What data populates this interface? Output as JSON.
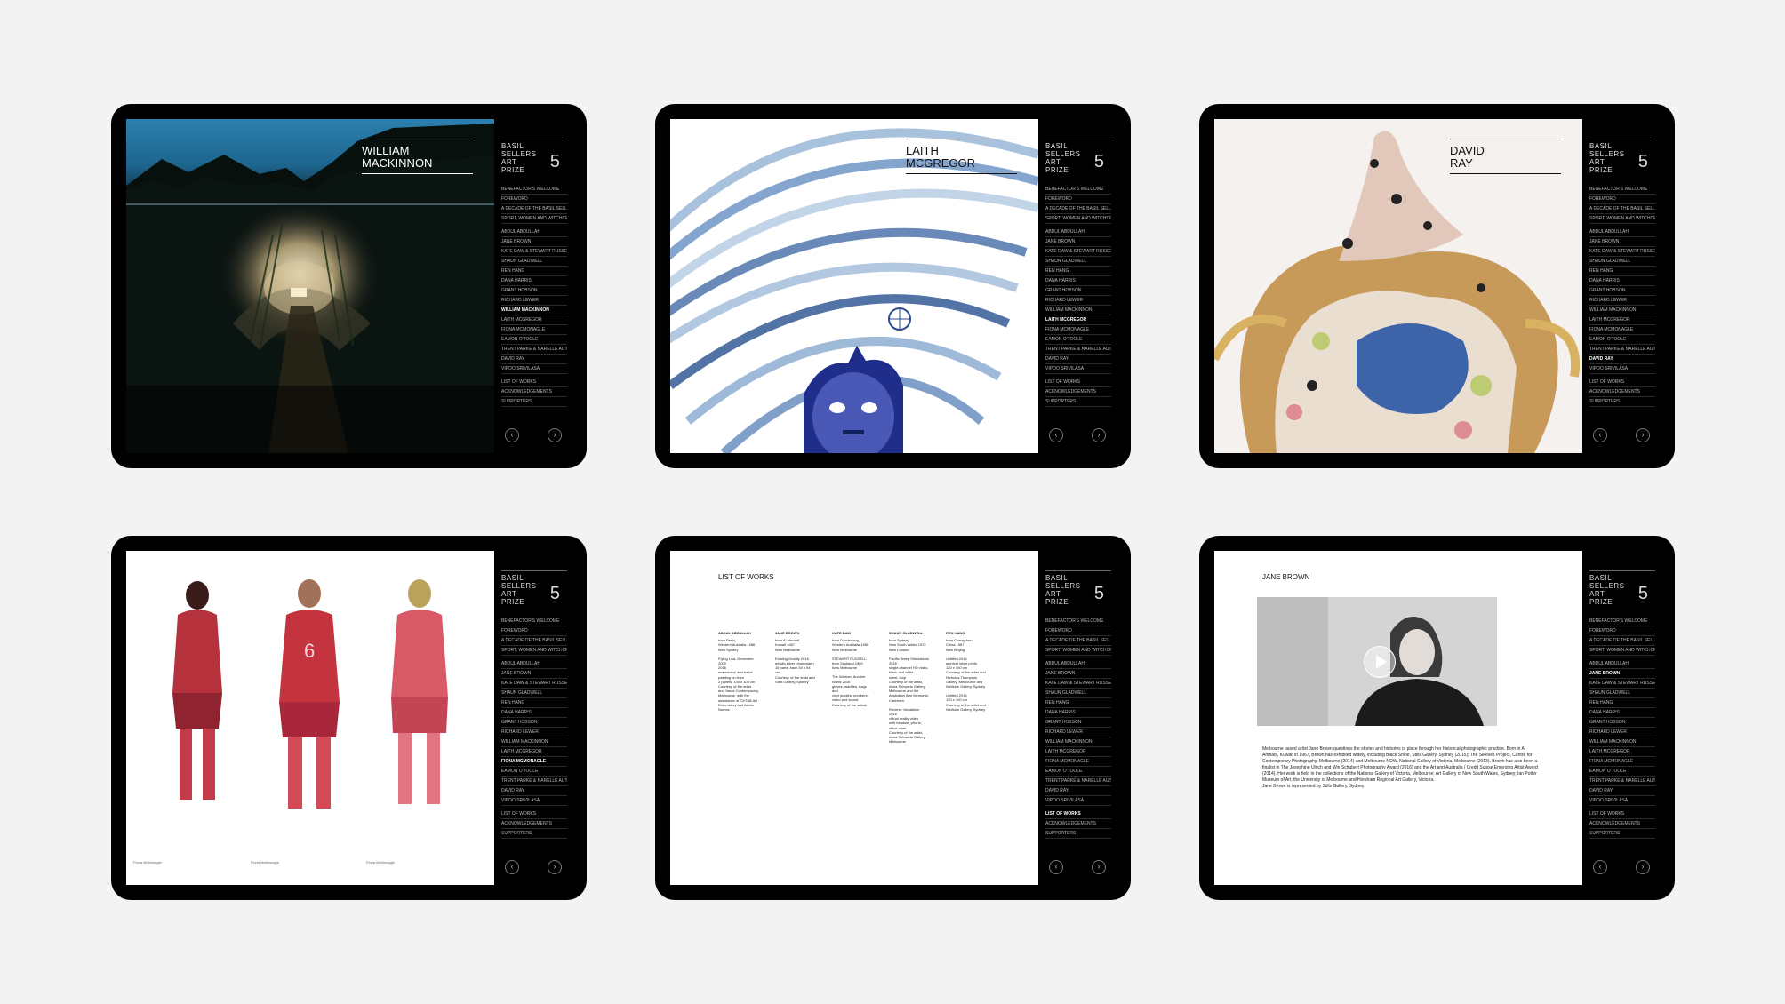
{
  "sidebar": {
    "logo": [
      "BASIL",
      "SELLERS",
      "ART",
      "PRIZE"
    ],
    "logo_number": "5",
    "nav_top": [
      "BENEFACTOR'S WELCOME",
      "FOREWORD",
      "A DECADE OF THE BASIL SELLERS ART PRIZE",
      "SPORT, WOMEN AND WITCHCRAFT"
    ],
    "nav_artists": [
      "ABDUL ABDULLAH",
      "JANE BROWN",
      "KATE DAW & STEWART RUSSELL",
      "SHAUN GLADWELL",
      "REN HANG",
      "DANA HARRIS",
      "GRANT HOBSON",
      "RICHARD LEWER",
      "WILLIAM MACKINNON",
      "LAITH McGREGOR",
      "FIONA McMONAGLE",
      "EAMON O'TOOLE",
      "TRENT PARKE & NARELLE AUTIO",
      "DAVID RAY",
      "VIPOO SRIVILASA"
    ],
    "nav_bottom": [
      "LIST OF WORKS",
      "ACKNOWLEDGEMENTS",
      "SUPPORTERS"
    ],
    "prev_icon": "‹",
    "next_icon": "›"
  },
  "tablets": {
    "t1": {
      "title_line1": "WILLIAM",
      "title_line2": "MACKINNON",
      "active": "WILLIAM MACKINNON"
    },
    "t2": {
      "title_line1": "LAITH",
      "title_line2": "McGREGOR",
      "active": "LAITH McGREGOR"
    },
    "t3": {
      "title_line1": "DAVID",
      "title_line2": "RAY",
      "active": "DAVID RAY"
    },
    "t4": {
      "active": "FIONA McMONAGLE",
      "captions": [
        "Fiona McMonagle",
        "Fiona McMonagle",
        "Fiona McMonagle"
      ]
    },
    "t5": {
      "heading": "LIST OF WORKS",
      "active": "LIST OF WORKS"
    },
    "t6": {
      "heading": "JANE BROWN",
      "active": "JANE BROWN",
      "bio_1": "Melbourne based artist Jane Brown questions the stories and histories of place through her historical photographic practice. Born in Al Ahmadi, Kuwait in 1967, Brown has exhibited widely, including Black Shipe, Stills Gallery, Sydney (2015); The Sleeves Project, Centre for Contemporary Photography, Melbourne (2014) and Melbourne NOW, National Gallery of Victoria, Melbourne (2013). Brown has also been a finalist in The Josephine Ulrich and Win Schubert Photography Award (2016) and the Art and Australia / Credit Suisse Emerging Artist Award (2014). Her work is held in the collections of the National Gallery of Victoria, Melbourne; Art Gallery of New South Wales, Sydney; Ian Potter Museum of Art, the University of Melbourne and Horsham Regional Art Gallery, Victoria.",
      "bio_2": "Jane Brown is represented by Stills Gallery, Sydney",
      "play_icon": "play-icon"
    }
  },
  "works": [
    {
      "artist": "ABDUL ABDULLAH",
      "lines": [
        "born Perth,",
        "Western Australia 1986",
        "lives Sydney",
        "",
        "Flying Lisa, December 2009",
        "2016",
        "embroidery and ballot",
        "painting on linen",
        "2 panels, 100 x 100 cm",
        "Courtesy of the artist",
        "and Yavuz Contemporary,",
        "Melbourne, with the",
        "assistance of OVTAB Art",
        "Embroidery and Atelier",
        "Nomos"
      ]
    },
    {
      "artist": "JANE BROWN",
      "lines": [
        "born Al Ahmadi,",
        "Kuwait 1967",
        "lives Melbourne",
        "",
        "Existing Gravity 2016",
        "gelatin silver photograph",
        "16 parts, each 54 x 54 cm",
        "Courtesy of the artist and",
        "Stills Gallery, Sydney"
      ]
    },
    {
      "artist": "KATE DAW",
      "lines": [
        "born Dandenong,",
        "Western Australia 1965",
        "lives Melbourne",
        "",
        "STEWART RUSSELL",
        "born Scotland 1960",
        "lives Melbourne",
        "",
        "The Woman, Another World 2016",
        "gloves, marbles, flags and",
        "vinyl juggling numbers,",
        "video and sound",
        "Courtesy of the artists"
      ]
    },
    {
      "artist": "SHAUN GLADWELL",
      "lines": [
        "born Sydney,",
        "New South Wales 1972",
        "lives London",
        "",
        "Pacific Sleep Simulations",
        "2016",
        "single-channel HD video,",
        "black and white,",
        "silent, loop",
        "Courtesy of the artist,",
        "Anna Schwartz Gallery,",
        "Melbourne and the",
        "Australian War Memorial,",
        "Canberra",
        "",
        "Reverse Vandalism",
        "2016",
        "virtual reality video",
        "with headset, phone,",
        "office chair",
        "Courtesy of the artist,",
        "Anna Schwartz Gallery,",
        "Melbourne"
      ]
    },
    {
      "artist": "REN HANG",
      "lines": [
        "born Changchun,",
        "China 1987",
        "lives Beijing",
        "",
        "Untitled 2016",
        "archival inkjet prints",
        "120 x 100 cm",
        "Courtesy of the artist and",
        "Nicholas Thompson",
        "Gallery, Melbourne and",
        "Wellside Gallery, Sydney",
        "",
        "Untitled 2016",
        "120 x 100 cm",
        "Courtesy of the artist and",
        "Wellside Gallery, Sydney"
      ]
    }
  ]
}
